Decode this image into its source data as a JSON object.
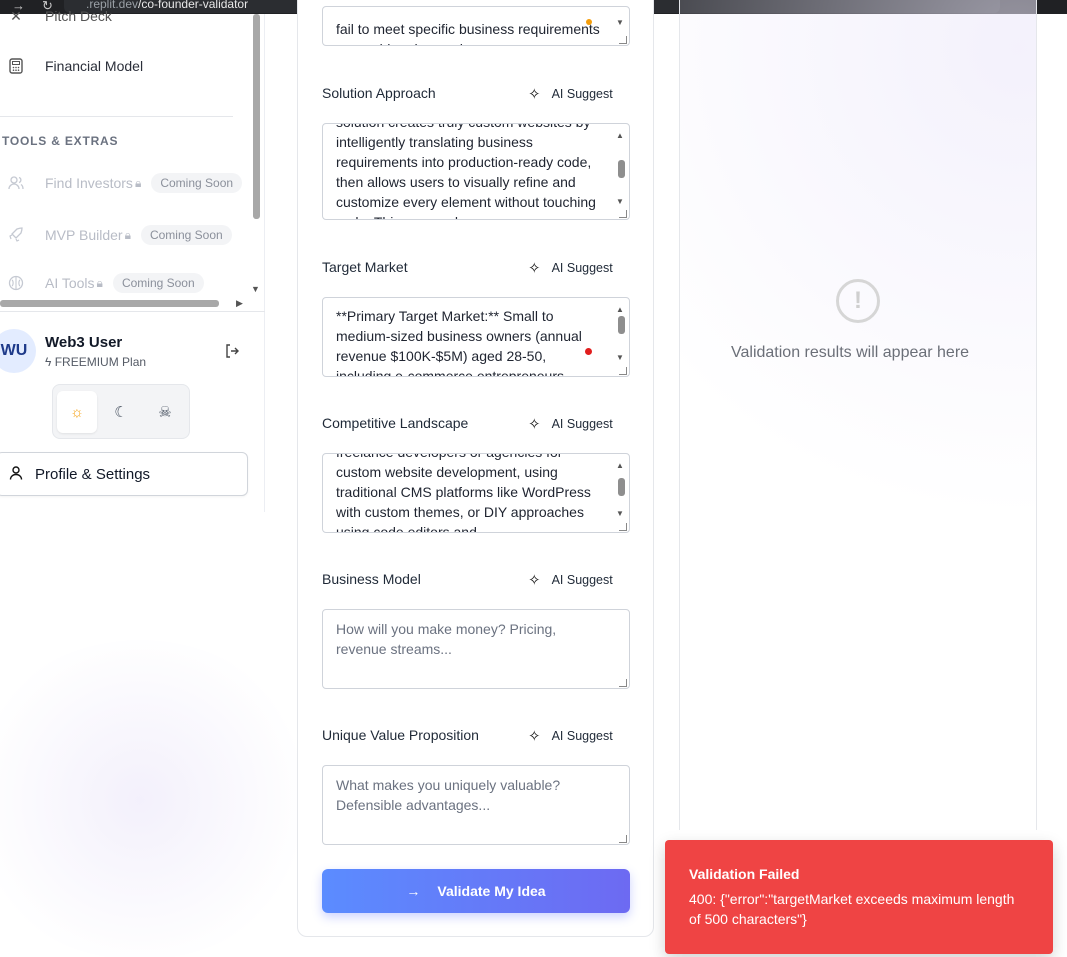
{
  "browser": {
    "url_prefix": ".replit.dev",
    "url_path": "/co-founder-validator"
  },
  "sidebar": {
    "items": [
      {
        "label": "Pitch Deck"
      },
      {
        "label": "Financial Model"
      }
    ],
    "tools_section_title": "TOOLS & EXTRAS",
    "tools": [
      {
        "label": "Find Investors",
        "badge": "Coming Soon"
      },
      {
        "label": "MVP Builder",
        "badge": "Coming Soon"
      },
      {
        "label": "AI Tools",
        "badge": "Coming Soon"
      }
    ],
    "user": {
      "initials": "WU",
      "name": "Web3 User",
      "plan": "FREEMIUM Plan"
    },
    "profile_button": "Profile & Settings"
  },
  "form": {
    "top_field_text": "fail to meet specific business requirements or provide advanced",
    "ai_suggest_label": "AI Suggest",
    "fields": [
      {
        "label": "Solution Approach",
        "value": "solution creates truly custom websites by intelligently translating business requirements into production-ready code, then allows users to visually refine and customize every element without touching code. This approach"
      },
      {
        "label": "Target Market",
        "value": "**Primary Target Market:** Small to medium-sized business owners (annual revenue $100K-$5M) aged 28-50, including e-commerce entrepreneurs"
      },
      {
        "label": "Competitive Landscape",
        "value": "freelance developers or agencies for custom website development, using traditional CMS platforms like WordPress with custom themes, or DIY approaches using code editors and"
      },
      {
        "label": "Business Model",
        "placeholder": "How will you make money? Pricing, revenue streams..."
      },
      {
        "label": "Unique Value Proposition",
        "placeholder": "What makes you uniquely valuable? Defensible advantages..."
      }
    ],
    "submit_label": "Validate My Idea"
  },
  "results": {
    "empty_text": "Validation results will appear here"
  },
  "toast": {
    "title": "Validation Failed",
    "message": "400: {\"error\":\"targetMarket exceeds maximum length of 500 characters\"}"
  },
  "colors": {
    "accent_start": "#5b8cff",
    "accent_end": "#6d6af2",
    "error": "#ef4444"
  }
}
